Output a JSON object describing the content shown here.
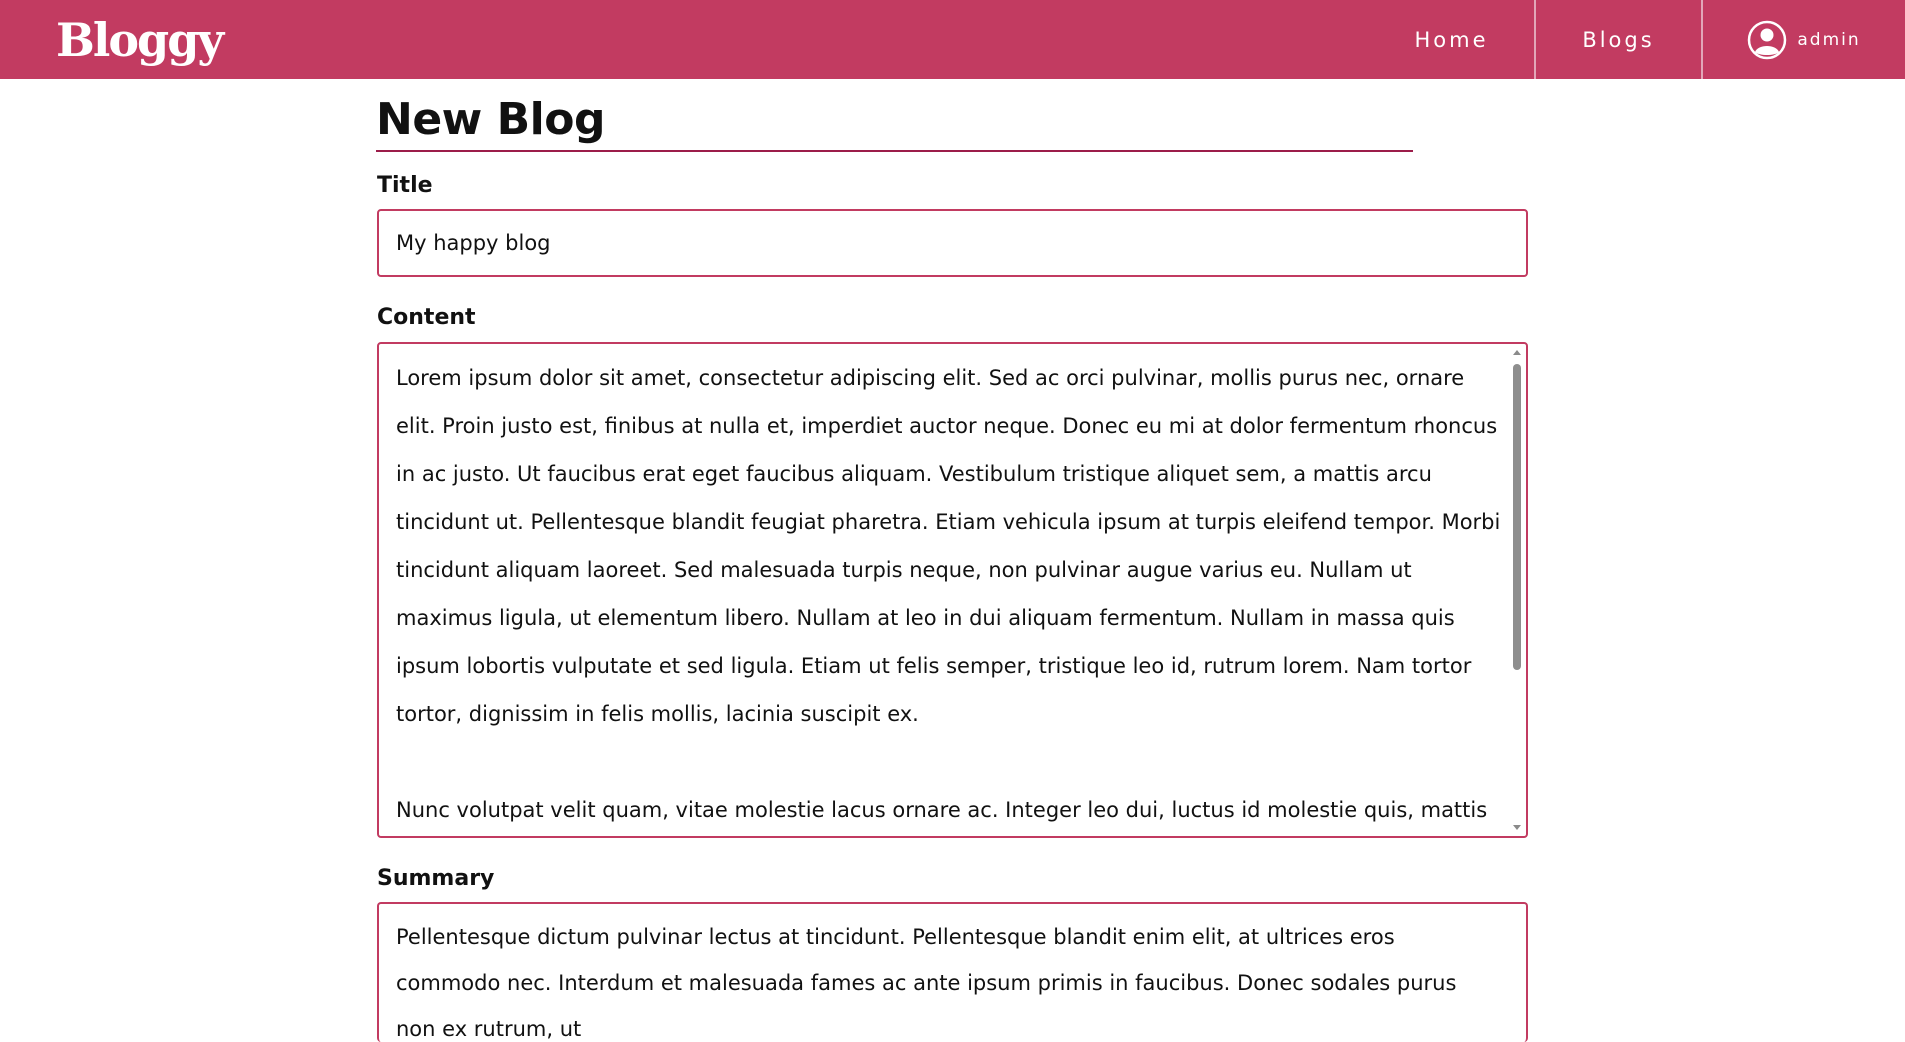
{
  "header": {
    "brand": "Bloggy",
    "nav": {
      "home": "Home",
      "blogs": "Blogs",
      "user": "admin"
    },
    "user_icon": "user-circle-icon",
    "colors": {
      "header_bg": "#c23b61",
      "accent": "#9c1d4a",
      "field_border": "#c23b61"
    }
  },
  "main": {
    "page_title": "New Blog",
    "form": {
      "title_label": "Title",
      "title_value": "My happy blog",
      "content_label": "Content",
      "content_paragraphs": [
        "Lorem ipsum dolor sit amet, consectetur adipiscing elit. Sed ac orci pulvinar, mollis purus nec, ornare elit. Proin justo est, finibus at nulla et, imperdiet auctor neque. Donec eu mi at dolor fermentum rhoncus in ac justo. Ut faucibus erat eget faucibus aliquam. Vestibulum tristique aliquet sem, a mattis arcu tincidunt ut. Pellentesque blandit feugiat pharetra. Etiam vehicula ipsum at turpis eleifend tempor. Morbi tincidunt aliquam laoreet. Sed malesuada turpis neque, non pulvinar augue varius eu. Nullam ut maximus ligula, ut elementum libero. Nullam at leo in dui aliquam fermentum. Nullam in massa quis ipsum lobortis vulputate et sed ligula. Etiam ut felis semper, tristique leo id, rutrum lorem. Nam tortor tortor, dignissim in felis mollis, lacinia suscipit ex.",
        "Nunc volutpat velit quam, vitae molestie lacus ornare ac. Integer leo dui, luctus id molestie quis, mattis"
      ],
      "summary_label": "Summary",
      "summary_text": "Pellentesque dictum pulvinar lectus at tincidunt. Pellentesque blandit enim elit, at ultrices eros commodo nec. Interdum et malesuada fames ac ante ipsum primis in faucibus. Donec sodales purus non ex rutrum, ut"
    }
  }
}
